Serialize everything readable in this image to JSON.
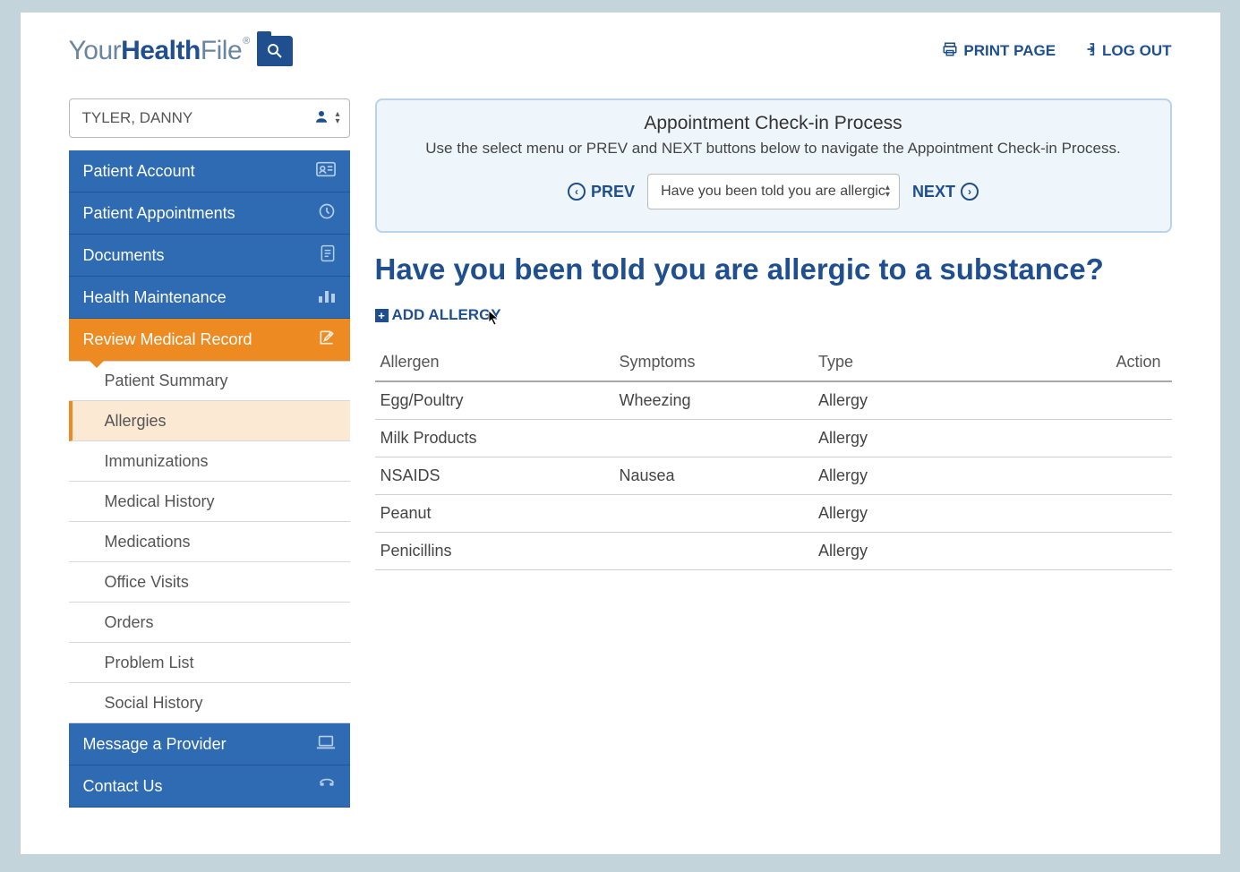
{
  "logo": {
    "part1": "Your",
    "part2": "Health",
    "part3": "File",
    "tm": "®"
  },
  "header": {
    "print": "PRINT PAGE",
    "logout": "LOG OUT"
  },
  "patient_selector": {
    "value": "TYLER, DANNY"
  },
  "nav": {
    "items": [
      "Patient Account",
      "Patient Appointments",
      "Documents",
      "Health Maintenance",
      "Review Medical Record",
      "Message a Provider",
      "Contact Us"
    ],
    "sub": [
      "Patient Summary",
      "Allergies",
      "Immunizations",
      "Medical History",
      "Medications",
      "Office Visits",
      "Orders",
      "Problem List",
      "Social History"
    ]
  },
  "checkin": {
    "title": "Appointment Check-in Process",
    "desc": "Use the select menu or PREV and NEXT buttons below to navigate the Appointment Check-in Process.",
    "prev": "PREV",
    "next": "NEXT",
    "step": "Have you been told you are allergic"
  },
  "page": {
    "title": "Have you been told you are allergic to a substance?",
    "add_label": "ADD ALLERGY"
  },
  "table": {
    "headers": {
      "allergen": "Allergen",
      "symptoms": "Symptoms",
      "type": "Type",
      "action": "Action"
    },
    "rows": [
      {
        "allergen": "Egg/Poultry",
        "symptoms": "Wheezing",
        "type": "Allergy"
      },
      {
        "allergen": "Milk Products",
        "symptoms": "",
        "type": "Allergy"
      },
      {
        "allergen": "NSAIDS",
        "symptoms": "Nausea",
        "type": "Allergy"
      },
      {
        "allergen": "Peanut",
        "symptoms": "",
        "type": "Allergy"
      },
      {
        "allergen": "Penicillins",
        "symptoms": "",
        "type": "Allergy"
      }
    ]
  }
}
